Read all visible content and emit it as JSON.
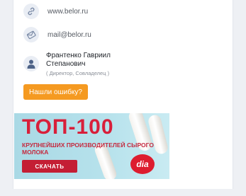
{
  "contacts": {
    "website": "www.belor.ru",
    "email": "mail@belor.ru"
  },
  "person": {
    "name": "Франтенко Гавриил Степанович",
    "role": "( Директор, Совладелец )"
  },
  "error_button_label": "Нашли ошибку?",
  "banner": {
    "title": "ТОП-100",
    "subtitle": "КРУПНЕЙШИХ ПРОИЗВОДИТЕЛЕЙ СЫРОГО МОЛОКА",
    "button_label": "СКАЧАТЬ",
    "logo_text": "dia"
  },
  "colors": {
    "accent_orange": "#f59a21",
    "banner_red": "#d81f3a",
    "icon_bg": "#e9edf4"
  },
  "icons": [
    "link-icon",
    "email-icon",
    "user-avatar-icon"
  ]
}
